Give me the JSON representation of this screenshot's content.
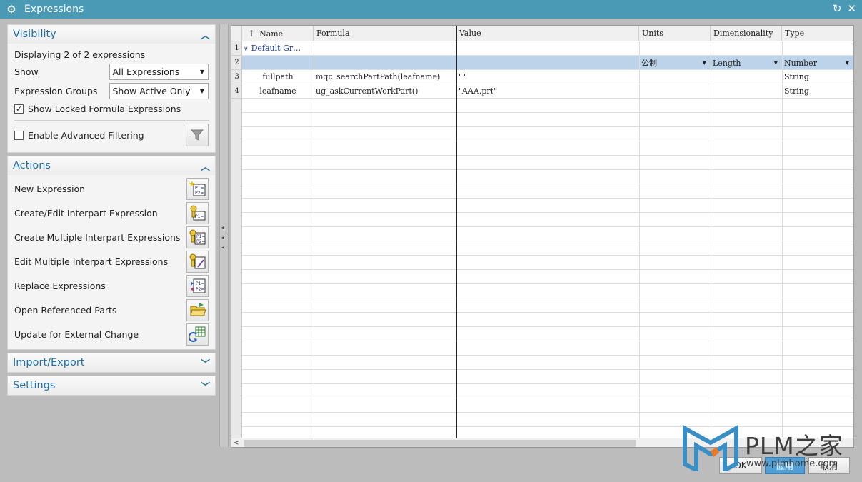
{
  "window": {
    "title": "Expressions",
    "icon": "gear-icon"
  },
  "visibility": {
    "title": "Visibility",
    "displaying": "Displaying 2 of 2 expressions",
    "show_label": "Show",
    "show_value": "All Expressions",
    "groups_label": "Expression Groups",
    "groups_value": "Show Active Only",
    "locked_label": "Show Locked Formula Expressions",
    "locked_checked": true,
    "advanced_label": "Enable Advanced Filtering",
    "advanced_checked": false
  },
  "actions": {
    "title": "Actions",
    "items": [
      {
        "label": "New Expression",
        "icon": "new-expression-icon"
      },
      {
        "label": "Create/Edit Interpart Expression",
        "icon": "interpart-expression-icon"
      },
      {
        "label": "Create Multiple Interpart Expressions",
        "icon": "multiple-interpart-icon"
      },
      {
        "label": "Edit Multiple Interpart Expressions",
        "icon": "edit-multiple-interpart-icon"
      },
      {
        "label": "Replace Expressions",
        "icon": "replace-expressions-icon"
      },
      {
        "label": "Open Referenced Parts",
        "icon": "open-folder-icon"
      },
      {
        "label": "Update for External Change",
        "icon": "update-external-icon"
      }
    ]
  },
  "import_export": {
    "title": "Import/Export"
  },
  "settings": {
    "title": "Settings"
  },
  "grid": {
    "columns": [
      "Name",
      "Formula",
      "Value",
      "Units",
      "Dimensionality",
      "Type"
    ],
    "sort_indicator": "↑",
    "rows": [
      {
        "num": "1",
        "name": "Default Gr…",
        "formula": "",
        "value": "",
        "units": "",
        "dimensionality": "",
        "type": ""
      },
      {
        "num": "2",
        "name": "",
        "formula": "",
        "value": "",
        "units": "公制",
        "dimensionality": "Length",
        "type": "Number"
      },
      {
        "num": "3",
        "name": "fullpath",
        "formula": "mqc_searchPartPath(leafname)",
        "value": "\"\"",
        "units": "",
        "dimensionality": "",
        "type": "String"
      },
      {
        "num": "4",
        "name": "leafname",
        "formula": "ug_askCurrentWorkPart()",
        "value": "\"AAA.prt\"",
        "units": "",
        "dimensionality": "",
        "type": "String"
      }
    ]
  },
  "buttons": {
    "ok": "OK",
    "apply": "应用",
    "cancel": "取消"
  },
  "watermark": {
    "brand": "PLM之家",
    "url": "www.plmhome.com"
  },
  "colors": {
    "titlebar": "#4a9ab6",
    "accent": "#1f6fa6",
    "selection": "#bcd3ea"
  }
}
